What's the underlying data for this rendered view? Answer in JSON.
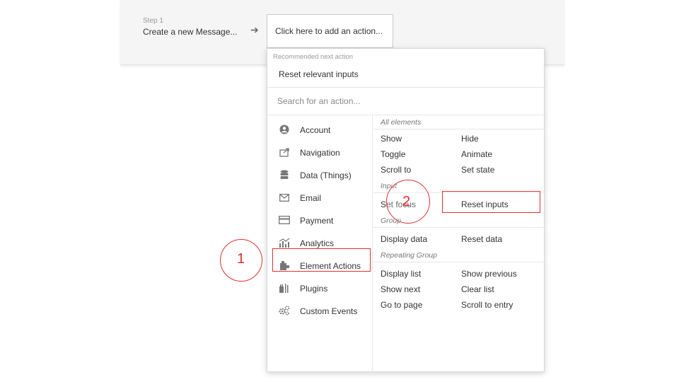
{
  "workflow": {
    "step_label": "Step 1",
    "step_title": "Create a new Message...",
    "arrow": "➔",
    "add_action_label": "Click here to add an action..."
  },
  "dropdown": {
    "recommended_label": "Recommended next action",
    "recommended_item": "Reset relevant inputs",
    "search_placeholder": "Search for an action...",
    "categories": [
      {
        "label": "Account",
        "icon": "account-icon"
      },
      {
        "label": "Navigation",
        "icon": "navigation-icon"
      },
      {
        "label": "Data (Things)",
        "icon": "database-icon"
      },
      {
        "label": "Email",
        "icon": "email-icon"
      },
      {
        "label": "Payment",
        "icon": "payment-icon"
      },
      {
        "label": "Analytics",
        "icon": "analytics-icon"
      },
      {
        "label": "Element Actions",
        "icon": "element-actions-icon"
      },
      {
        "label": "Plugins",
        "icon": "plugins-icon"
      },
      {
        "label": "Custom Events",
        "icon": "custom-events-icon"
      }
    ],
    "groups": {
      "all_elements": {
        "title": "All elements",
        "actions": [
          "Show",
          "Hide",
          "Toggle",
          "Animate",
          "Scroll to",
          "Set state"
        ]
      },
      "input": {
        "title": "Input",
        "actions": [
          "Set focus",
          "Reset inputs"
        ]
      },
      "group": {
        "title": "Group",
        "actions": [
          "Display data",
          "Reset data"
        ]
      },
      "repeating_group": {
        "title": "Repeating Group",
        "actions": [
          "Display list",
          "Show previous",
          "Show next",
          "Clear list",
          "Go to page",
          "Scroll to entry"
        ]
      }
    }
  },
  "annotations": {
    "marker_1": "1",
    "marker_2": "2",
    "color": "#e03030"
  }
}
